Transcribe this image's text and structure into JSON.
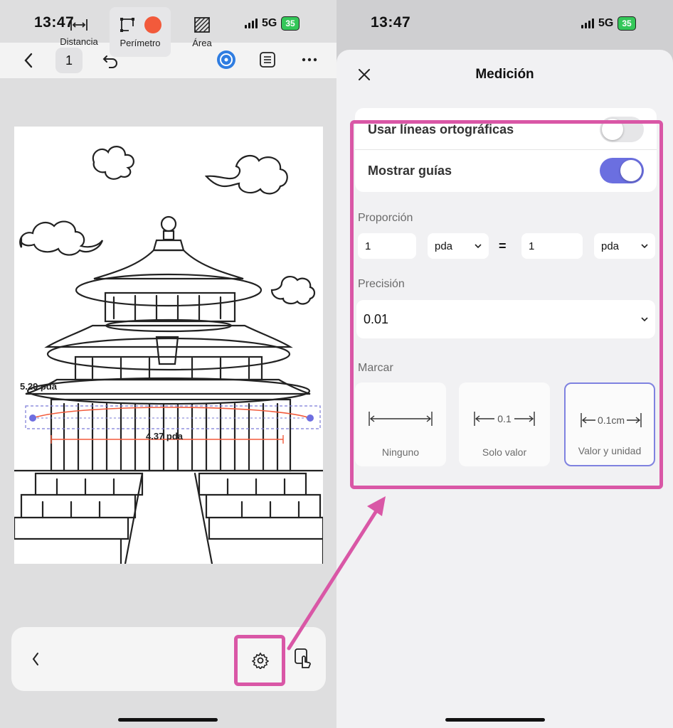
{
  "left": {
    "status": {
      "time": "13:47",
      "network": "5G",
      "battery": "35"
    },
    "topbar": {
      "page_number": "1"
    },
    "document": {
      "measure_perimeter_label": "5.29 pda",
      "measure_width_label": "4.37 pda"
    },
    "toolbar": {
      "tools": [
        {
          "label": "Distancia"
        },
        {
          "label": "Perímetro"
        },
        {
          "label": "Área"
        }
      ],
      "perimeter_color": "#f25a3b"
    }
  },
  "right": {
    "status": {
      "time": "13:47",
      "network": "5G",
      "battery": "35"
    },
    "sheet": {
      "title": "Medición",
      "orthographic_label": "Usar líneas ortográficas",
      "orthographic_on": false,
      "guides_label": "Mostrar guías",
      "guides_on": true,
      "toggle_on_color": "#6b6fe0",
      "proportion": {
        "label": "Proporción",
        "left_value": "1",
        "left_unit": "pda",
        "equals": "=",
        "right_value": "1",
        "right_unit": "pda"
      },
      "precision": {
        "label": "Precisión",
        "value": "0.01"
      },
      "mark": {
        "label": "Marcar",
        "options": [
          {
            "label": "Ninguno",
            "diagram": ""
          },
          {
            "label": "Solo valor",
            "diagram": "0.1"
          },
          {
            "label": "Valor y unidad",
            "diagram": "0.1cm"
          }
        ],
        "selected": "Valor y unidad"
      }
    }
  },
  "annotation_color": "#d957a6"
}
